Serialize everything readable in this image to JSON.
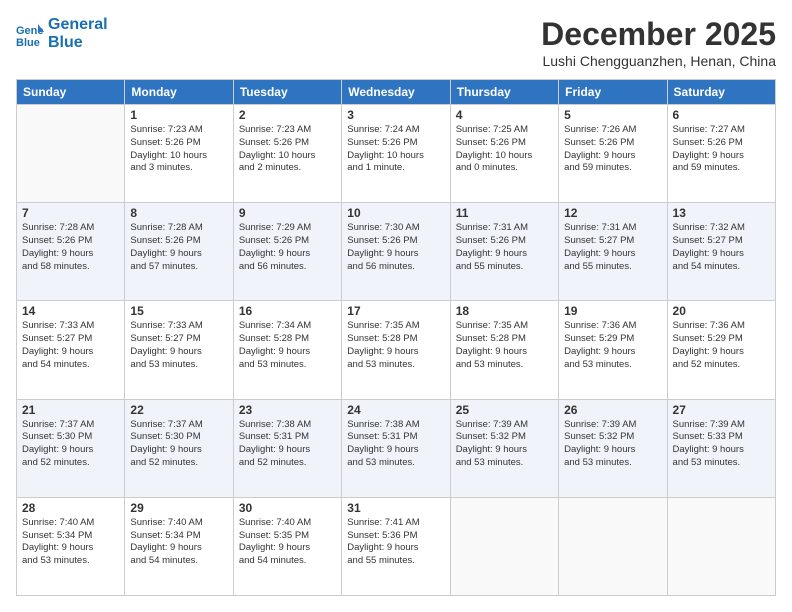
{
  "header": {
    "logo_line1": "General",
    "logo_line2": "Blue",
    "month": "December 2025",
    "location": "Lushi Chengguanzhen, Henan, China"
  },
  "weekdays": [
    "Sunday",
    "Monday",
    "Tuesday",
    "Wednesday",
    "Thursday",
    "Friday",
    "Saturday"
  ],
  "weeks": [
    [
      {
        "day": "",
        "info": ""
      },
      {
        "day": "1",
        "info": "Sunrise: 7:23 AM\nSunset: 5:26 PM\nDaylight: 10 hours\nand 3 minutes."
      },
      {
        "day": "2",
        "info": "Sunrise: 7:23 AM\nSunset: 5:26 PM\nDaylight: 10 hours\nand 2 minutes."
      },
      {
        "day": "3",
        "info": "Sunrise: 7:24 AM\nSunset: 5:26 PM\nDaylight: 10 hours\nand 1 minute."
      },
      {
        "day": "4",
        "info": "Sunrise: 7:25 AM\nSunset: 5:26 PM\nDaylight: 10 hours\nand 0 minutes."
      },
      {
        "day": "5",
        "info": "Sunrise: 7:26 AM\nSunset: 5:26 PM\nDaylight: 9 hours\nand 59 minutes."
      },
      {
        "day": "6",
        "info": "Sunrise: 7:27 AM\nSunset: 5:26 PM\nDaylight: 9 hours\nand 59 minutes."
      }
    ],
    [
      {
        "day": "7",
        "info": "Sunrise: 7:28 AM\nSunset: 5:26 PM\nDaylight: 9 hours\nand 58 minutes."
      },
      {
        "day": "8",
        "info": "Sunrise: 7:28 AM\nSunset: 5:26 PM\nDaylight: 9 hours\nand 57 minutes."
      },
      {
        "day": "9",
        "info": "Sunrise: 7:29 AM\nSunset: 5:26 PM\nDaylight: 9 hours\nand 56 minutes."
      },
      {
        "day": "10",
        "info": "Sunrise: 7:30 AM\nSunset: 5:26 PM\nDaylight: 9 hours\nand 56 minutes."
      },
      {
        "day": "11",
        "info": "Sunrise: 7:31 AM\nSunset: 5:26 PM\nDaylight: 9 hours\nand 55 minutes."
      },
      {
        "day": "12",
        "info": "Sunrise: 7:31 AM\nSunset: 5:27 PM\nDaylight: 9 hours\nand 55 minutes."
      },
      {
        "day": "13",
        "info": "Sunrise: 7:32 AM\nSunset: 5:27 PM\nDaylight: 9 hours\nand 54 minutes."
      }
    ],
    [
      {
        "day": "14",
        "info": "Sunrise: 7:33 AM\nSunset: 5:27 PM\nDaylight: 9 hours\nand 54 minutes."
      },
      {
        "day": "15",
        "info": "Sunrise: 7:33 AM\nSunset: 5:27 PM\nDaylight: 9 hours\nand 53 minutes."
      },
      {
        "day": "16",
        "info": "Sunrise: 7:34 AM\nSunset: 5:28 PM\nDaylight: 9 hours\nand 53 minutes."
      },
      {
        "day": "17",
        "info": "Sunrise: 7:35 AM\nSunset: 5:28 PM\nDaylight: 9 hours\nand 53 minutes."
      },
      {
        "day": "18",
        "info": "Sunrise: 7:35 AM\nSunset: 5:28 PM\nDaylight: 9 hours\nand 53 minutes."
      },
      {
        "day": "19",
        "info": "Sunrise: 7:36 AM\nSunset: 5:29 PM\nDaylight: 9 hours\nand 53 minutes."
      },
      {
        "day": "20",
        "info": "Sunrise: 7:36 AM\nSunset: 5:29 PM\nDaylight: 9 hours\nand 52 minutes."
      }
    ],
    [
      {
        "day": "21",
        "info": "Sunrise: 7:37 AM\nSunset: 5:30 PM\nDaylight: 9 hours\nand 52 minutes."
      },
      {
        "day": "22",
        "info": "Sunrise: 7:37 AM\nSunset: 5:30 PM\nDaylight: 9 hours\nand 52 minutes."
      },
      {
        "day": "23",
        "info": "Sunrise: 7:38 AM\nSunset: 5:31 PM\nDaylight: 9 hours\nand 52 minutes."
      },
      {
        "day": "24",
        "info": "Sunrise: 7:38 AM\nSunset: 5:31 PM\nDaylight: 9 hours\nand 53 minutes."
      },
      {
        "day": "25",
        "info": "Sunrise: 7:39 AM\nSunset: 5:32 PM\nDaylight: 9 hours\nand 53 minutes."
      },
      {
        "day": "26",
        "info": "Sunrise: 7:39 AM\nSunset: 5:32 PM\nDaylight: 9 hours\nand 53 minutes."
      },
      {
        "day": "27",
        "info": "Sunrise: 7:39 AM\nSunset: 5:33 PM\nDaylight: 9 hours\nand 53 minutes."
      }
    ],
    [
      {
        "day": "28",
        "info": "Sunrise: 7:40 AM\nSunset: 5:34 PM\nDaylight: 9 hours\nand 53 minutes."
      },
      {
        "day": "29",
        "info": "Sunrise: 7:40 AM\nSunset: 5:34 PM\nDaylight: 9 hours\nand 54 minutes."
      },
      {
        "day": "30",
        "info": "Sunrise: 7:40 AM\nSunset: 5:35 PM\nDaylight: 9 hours\nand 54 minutes."
      },
      {
        "day": "31",
        "info": "Sunrise: 7:41 AM\nSunset: 5:36 PM\nDaylight: 9 hours\nand 55 minutes."
      },
      {
        "day": "",
        "info": ""
      },
      {
        "day": "",
        "info": ""
      },
      {
        "day": "",
        "info": ""
      }
    ]
  ]
}
